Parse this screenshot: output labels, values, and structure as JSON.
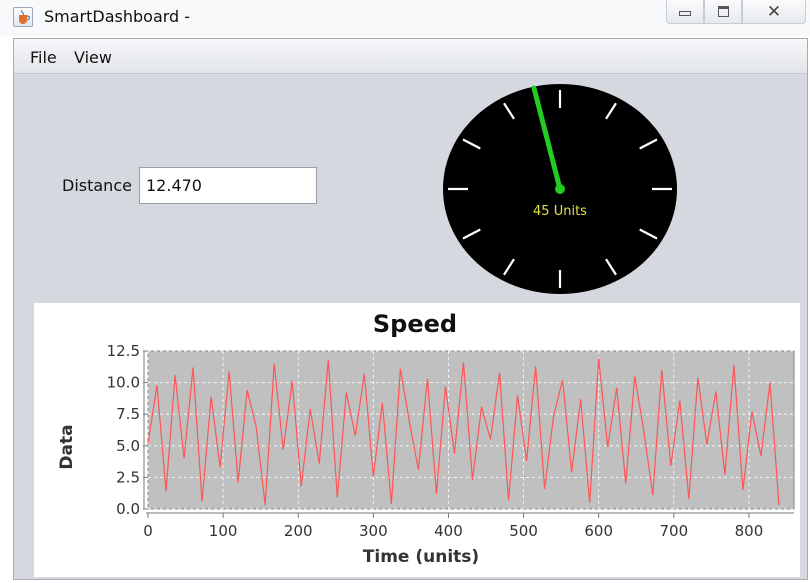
{
  "window": {
    "title": "SmartDashboard -",
    "app_icon": "java-cup-icon"
  },
  "window_controls": {
    "minimize": "minimize-icon",
    "restore": "restore-icon",
    "close": "close-icon"
  },
  "menu": {
    "items": [
      "File",
      "View"
    ]
  },
  "distance": {
    "label": "Distance",
    "value": "12.470"
  },
  "gauge": {
    "value": 45,
    "units_label": "45 Units",
    "needle_color": "#22cc22",
    "text_color": "#e6e04a"
  },
  "chart_data": {
    "type": "line",
    "title": "Speed",
    "xlabel": "Time (units)",
    "ylabel": "Data",
    "xlim": [
      0,
      860
    ],
    "ylim": [
      0,
      12.5
    ],
    "x_ticks": [
      0,
      100,
      200,
      300,
      400,
      500,
      600,
      700,
      800
    ],
    "y_ticks": [
      0.0,
      2.5,
      5.0,
      7.5,
      10.0,
      12.5
    ],
    "x_tick_labels": [
      "0",
      "100",
      "200",
      "300",
      "400",
      "500",
      "600",
      "700",
      "800"
    ],
    "y_tick_labels": [
      "0.0",
      "2.5",
      "5.0",
      "7.5",
      "10.0",
      "12.5"
    ],
    "grid": true,
    "series_color": "#ff5555",
    "plot_background": "#c0c0c0",
    "series": [
      {
        "x_start": 0,
        "x_step": 10,
        "values": [
          5.2,
          9.8,
          1.4,
          10.6,
          4.0,
          11.2,
          0.6,
          8.9,
          3.3,
          10.9,
          2.1,
          9.4,
          6.5,
          0.3,
          11.5,
          4.7,
          10.1,
          1.8,
          7.9,
          3.6,
          11.8,
          0.9,
          9.2,
          5.8,
          10.7,
          2.6,
          8.4,
          0.4,
          11.1,
          6.9,
          3.1,
          10.3,
          1.2,
          9.7,
          4.4,
          11.6,
          2.3,
          8.1,
          5.5,
          10.8,
          0.7,
          9.0,
          3.8,
          11.3,
          1.6,
          7.4,
          10.2,
          2.9,
          8.7,
          0.5,
          11.9,
          4.9,
          9.6,
          2.0,
          10.5,
          6.2,
          1.1,
          11.0,
          3.4,
          8.6,
          0.8,
          10.4,
          5.1,
          9.3,
          2.7,
          11.4,
          1.5,
          7.7,
          4.2,
          10.0,
          0.3
        ]
      }
    ]
  }
}
